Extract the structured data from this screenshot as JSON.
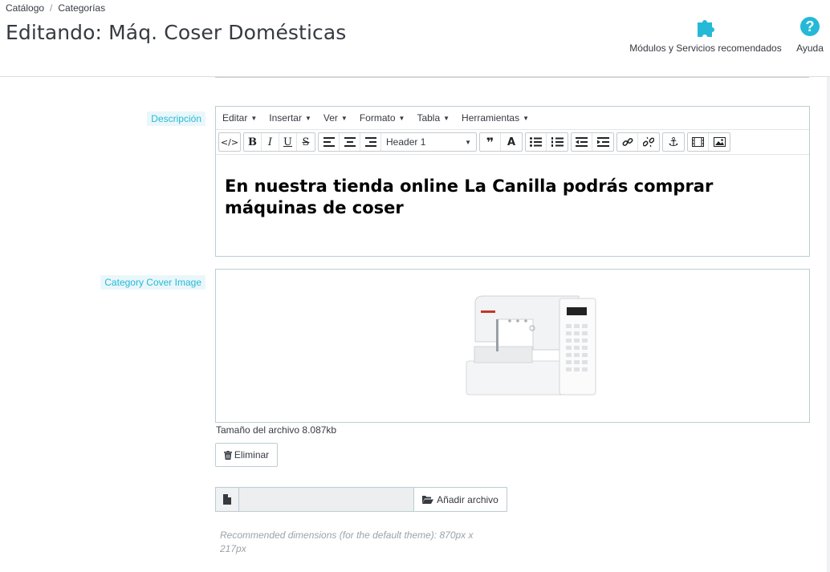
{
  "header": {
    "breadcrumb": [
      "Catálogo",
      "Categorías"
    ],
    "title": "Editando: Máq. Coser Domésticas",
    "modules_label": "Módulos y Servicios recomendados",
    "help_label": "Ayuda",
    "help_glyph": "?"
  },
  "form": {
    "description_label": "Descripción",
    "editor": {
      "menus": [
        "Editar",
        "Insertar",
        "Ver",
        "Formato",
        "Tabla",
        "Herramientas"
      ],
      "format_select": "Header 1",
      "content": "En nuestra tienda online La Canilla podrás comprar máquinas de coser"
    },
    "cover_label": "Category Cover Image",
    "file_size": "Tamaño del archivo 8.087kb",
    "delete_label": "Eliminar",
    "add_file_label": "Añadir archivo",
    "hint": "Recommended dimensions (for the default theme): 870px x 217px"
  },
  "colors": {
    "accent": "#25b9d7",
    "text": "#363a41",
    "border": "#bbcdd2"
  }
}
